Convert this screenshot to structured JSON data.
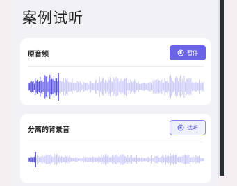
{
  "page": {
    "title": "案例试听"
  },
  "cards": [
    {
      "title": "原音频",
      "button_label": "暂停",
      "button_icon": "pause-icon",
      "played_fraction": 0.17
    },
    {
      "title": "分离的背景音",
      "button_label": "试听",
      "button_icon": "play-icon",
      "played_fraction": 0.04
    }
  ],
  "colors": {
    "accent": "#6b63e6",
    "wave_played": "#4a44d9",
    "wave_unplayed": "#c7c6f7",
    "background": "#f5eef0"
  }
}
